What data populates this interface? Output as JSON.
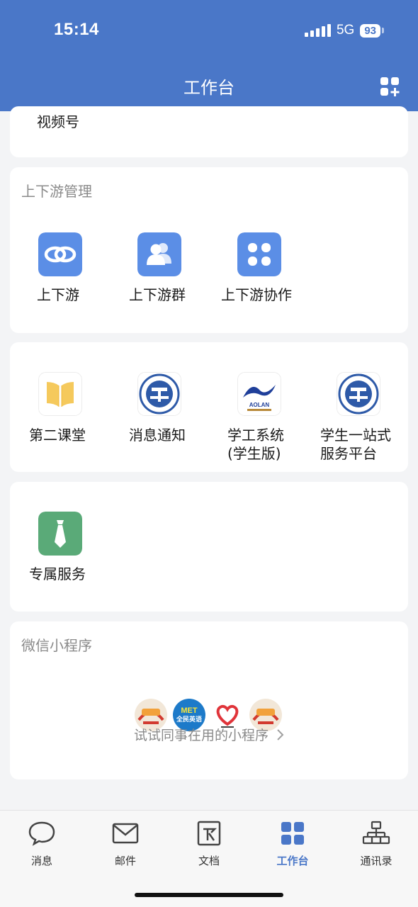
{
  "status_bar": {
    "time": "15:14",
    "network": "5G",
    "battery": "93"
  },
  "header": {
    "title": "工作台"
  },
  "top_card": {
    "item_label": "视频号"
  },
  "upstream": {
    "title": "上下游管理",
    "apps": [
      {
        "label": "上下游",
        "icon": "link-icon"
      },
      {
        "label": "上下游群",
        "icon": "group-icon"
      },
      {
        "label": "上下游协作",
        "icon": "grid-dots-icon"
      }
    ]
  },
  "school_apps": [
    {
      "label": "第二课堂",
      "icon": "book-icon"
    },
    {
      "label": "消息通知",
      "icon": "university-seal-icon"
    },
    {
      "label_lines": [
        "学工系统",
        "(学生版)"
      ],
      "icon": "aolan-logo-icon",
      "logo_text": "AOLAN"
    },
    {
      "label_lines": [
        "学生一站式",
        "服务平台"
      ],
      "icon": "university-seal-icon"
    }
  ],
  "exclusive": {
    "label": "专属服务",
    "icon": "tie-icon"
  },
  "mini_programs": {
    "title": "微信小程序",
    "try_text": "试试同事在用的小程序",
    "logo_texts": [
      "MET",
      "全民英语"
    ]
  },
  "tabbar": [
    {
      "label": "消息",
      "icon": "chat-bubble-icon",
      "active": false
    },
    {
      "label": "邮件",
      "icon": "mail-icon",
      "active": false
    },
    {
      "label": "文档",
      "icon": "document-icon",
      "active": false
    },
    {
      "label": "工作台",
      "icon": "workbench-grid-icon",
      "active": true
    },
    {
      "label": "通讯录",
      "icon": "org-chart-icon",
      "active": false
    }
  ],
  "colors": {
    "brand": "#4a77c8",
    "app_blue": "#5b8ee6",
    "service_green": "#5aaa78",
    "book_yellow": "#f5c95c"
  }
}
